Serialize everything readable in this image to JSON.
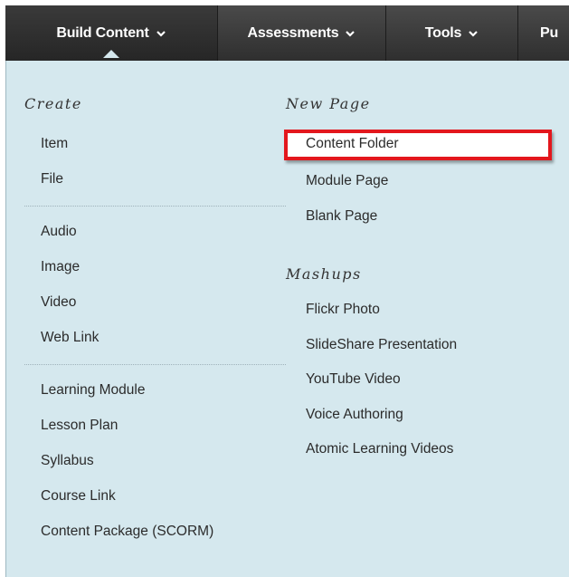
{
  "tabs": [
    {
      "label": "Build Content",
      "icon": "chevron-down-icon"
    },
    {
      "label": "Assessments",
      "icon": "chevron-down-icon"
    },
    {
      "label": "Tools",
      "icon": "chevron-down-icon"
    },
    {
      "label": "Pu"
    }
  ],
  "create": {
    "heading": "Create",
    "items": [
      "Item",
      "File",
      "Audio",
      "Image",
      "Video",
      "Web Link",
      "Learning Module",
      "Lesson Plan",
      "Syllabus",
      "Course Link",
      "Content Package (SCORM)"
    ]
  },
  "new_page": {
    "heading": "New Page",
    "items": [
      "Content Folder",
      "Module Page",
      "Blank Page"
    ]
  },
  "mashups": {
    "heading": "Mashups",
    "items": [
      "Flickr Photo",
      "SlideShare Presentation",
      "YouTube Video",
      "Voice Authoring",
      "Atomic Learning Videos"
    ]
  },
  "colors": {
    "panel_bg": "#d5e8ee",
    "tabbar_bg": "#3a3a3a",
    "highlight_border": "#e3171d"
  }
}
